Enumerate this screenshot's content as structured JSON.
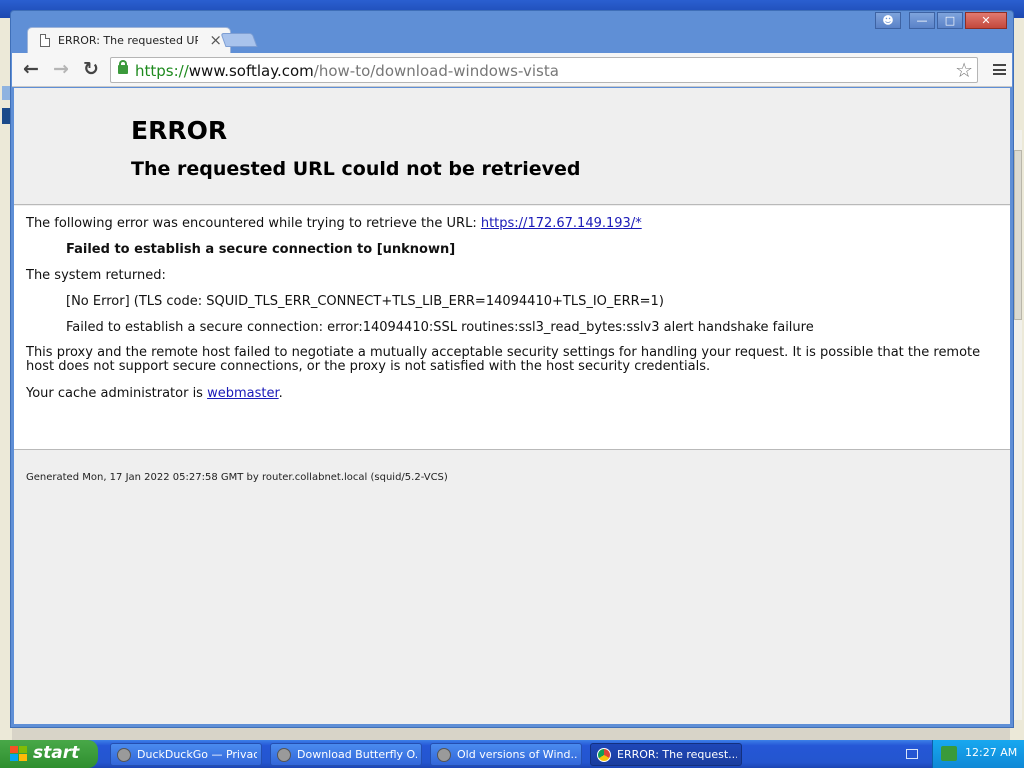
{
  "browser": {
    "tab_title": "ERROR: The requested URL",
    "url_scheme": "https://",
    "url_host": "www.softlay.com",
    "url_path": "/how-to/download-windows-vista"
  },
  "error_page": {
    "title": "ERROR",
    "subtitle": "The requested URL could not be retrieved",
    "intro": "The following error was encountered while trying to retrieve the URL: ",
    "url_link": "https://172.67.149.193/*",
    "failure": "Failed to establish a secure connection to [unknown]",
    "system_returned": "The system returned:",
    "tls_code": "[No Error] (TLS code: SQUID_TLS_ERR_CONNECT+TLS_LIB_ERR=14094410+TLS_IO_ERR=1)",
    "ssl_error": "Failed to establish a secure connection: error:14094410:SSL routines:ssl3_read_bytes:sslv3 alert handshake failure",
    "explanation": "This proxy and the remote host failed to negotiate a mutually acceptable security settings for handling your request. It is possible that the remote host does not support secure connections, or the proxy is not satisfied with the host security credentials.",
    "admin_prefix": "Your cache administrator is ",
    "admin_link": "webmaster",
    "admin_suffix": ".",
    "footer": "Generated Mon, 17 Jan 2022 05:27:58 GMT by router.collabnet.local (squid/5.2-VCS)"
  },
  "taskbar": {
    "start_label": "start",
    "tasks": [
      {
        "label": "DuckDuckGo — Privac..."
      },
      {
        "label": "Download Butterfly O..."
      },
      {
        "label": "Old versions of Wind..."
      },
      {
        "label": "ERROR: The request..."
      }
    ],
    "clock": "12:27 AM"
  },
  "icons": {
    "tab": "document-icon",
    "lock": "lock-icon",
    "star": "star-icon",
    "menu": "menu-icon",
    "task_browser": "browser-icon",
    "task_chrome": "chrome-icon"
  },
  "colors": {
    "link": "#1a1ab8",
    "secure_scheme": "#1e8a1e",
    "taskbar": "#2455cf",
    "start_button": "#2f8f2f"
  }
}
